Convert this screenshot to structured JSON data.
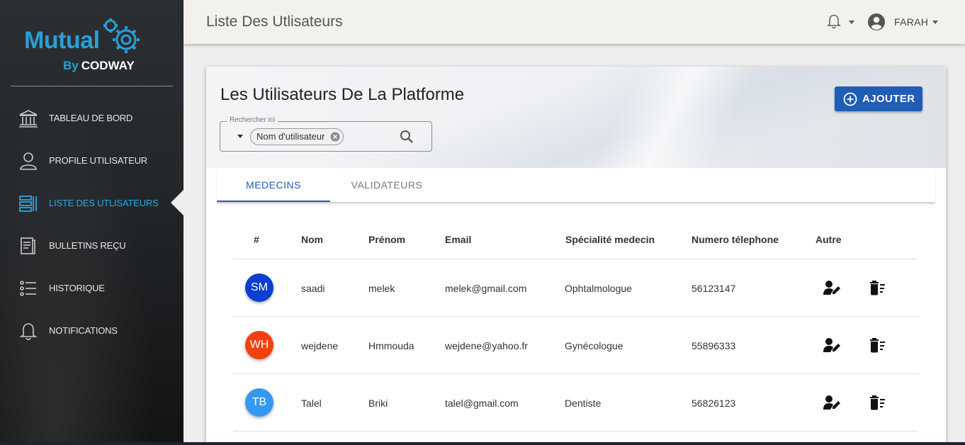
{
  "colors": {
    "accent": "#1f5db7",
    "sidebar_active": "#29a8e0",
    "logo_blue": "#2a9fd6"
  },
  "sidebar": {
    "logo": {
      "main": "Mutual",
      "by": "By",
      "brand": "CODWAY"
    },
    "items": [
      {
        "label": "TABLEAU DE BORD",
        "icon": "bank-icon"
      },
      {
        "label": "PROFILE UTILISATEUR",
        "icon": "person-icon"
      },
      {
        "label": "LISTE DES UTLISATEURS",
        "icon": "list-icon",
        "active": true
      },
      {
        "label": "BULLETINS REÇU",
        "icon": "document-icon"
      },
      {
        "label": "HISTORIQUE",
        "icon": "history-list-icon"
      },
      {
        "label": "NOTIFICATIONS",
        "icon": "bell-icon"
      }
    ]
  },
  "topbar": {
    "title": "Liste Des Utlisateurs",
    "user": "FARAH"
  },
  "card": {
    "title": "Les Utilisateurs De La Platforme",
    "search": {
      "legend": "Rechercher ici",
      "chip": "Nom d'utilisateur"
    },
    "add_label": "AJOUTER"
  },
  "tabs": [
    {
      "label": "MEDECINS",
      "active": true
    },
    {
      "label": "VALIDATEURS",
      "active": false
    }
  ],
  "table": {
    "headers": [
      "#",
      "Nom",
      "Prénom",
      "Email",
      "Spécialité medecin",
      "Numero télephone",
      "Autre"
    ],
    "rows": [
      {
        "initials": "SM",
        "color": "#0a3fcf",
        "nom": "saadi",
        "prenom": "melek",
        "email": "melek@gmail.com",
        "specialite": "Ophtalmologue",
        "tel": "56123147"
      },
      {
        "initials": "WH",
        "color": "#f2400f",
        "nom": "wejdene",
        "prenom": "Hmmouda",
        "email": "wejdene@yahoo.fr",
        "specialite": "Gynécologue",
        "tel": "55896333"
      },
      {
        "initials": "TB",
        "color": "#3399f0",
        "nom": "Talel",
        "prenom": "Briki",
        "email": "talel@gmail.com",
        "specialite": "Dentiste",
        "tel": "56826123"
      }
    ]
  }
}
